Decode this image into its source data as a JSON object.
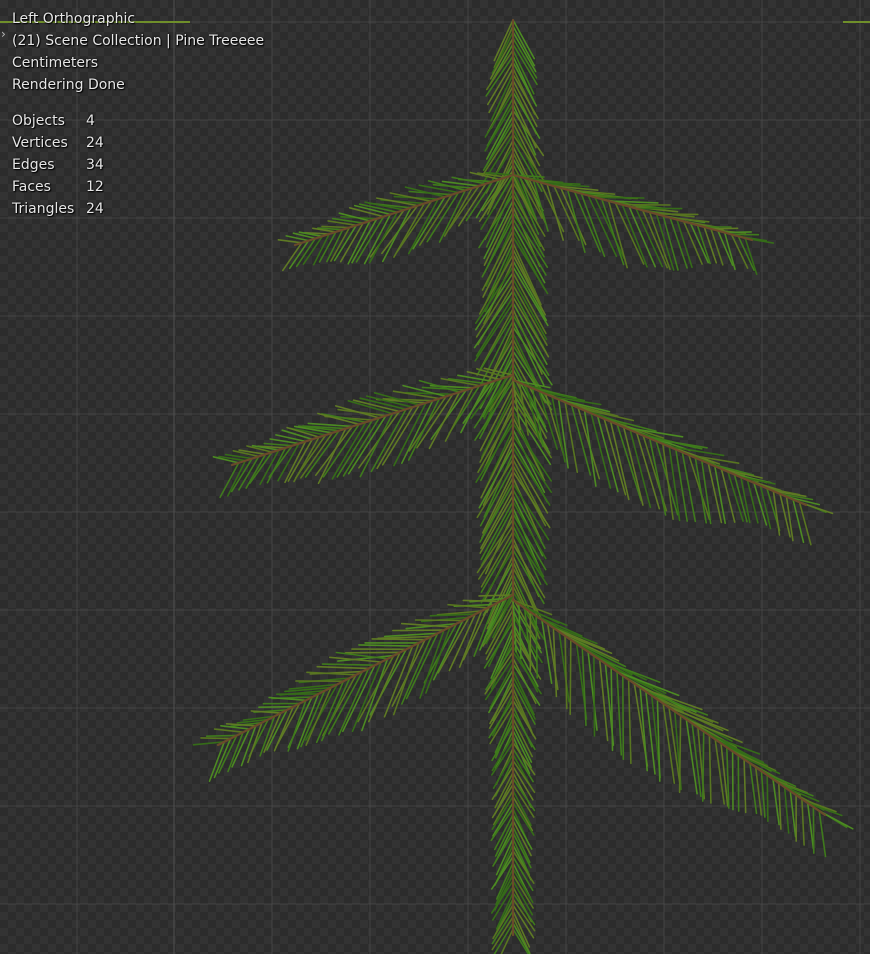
{
  "viewport": {
    "view_name": "Left Orthographic",
    "collection_line": "(21) Scene Collection | Pine Treeeee",
    "units": "Centimeters",
    "render_status": "Rendering Done"
  },
  "stats": [
    {
      "label": "Objects",
      "value": "4"
    },
    {
      "label": "Vertices",
      "value": "24"
    },
    {
      "label": "Edges",
      "value": "34"
    },
    {
      "label": "Faces",
      "value": "12"
    },
    {
      "label": "Triangles",
      "value": "24"
    }
  ],
  "colors": {
    "background": "#303030",
    "grid_line": "#555555",
    "needle_green": "#3f7a1c",
    "needle_olive": "#5f7a24",
    "branch_brown": "#6a4a2a",
    "axis_y": "#6f8f2a",
    "overlay_text": "#e6e6e6"
  },
  "icons": {
    "collapse_arrow": "chevron-right-icon"
  },
  "scene": {
    "object_name": "Pine Treeeee",
    "object_type": "pine-branch-sprite"
  }
}
